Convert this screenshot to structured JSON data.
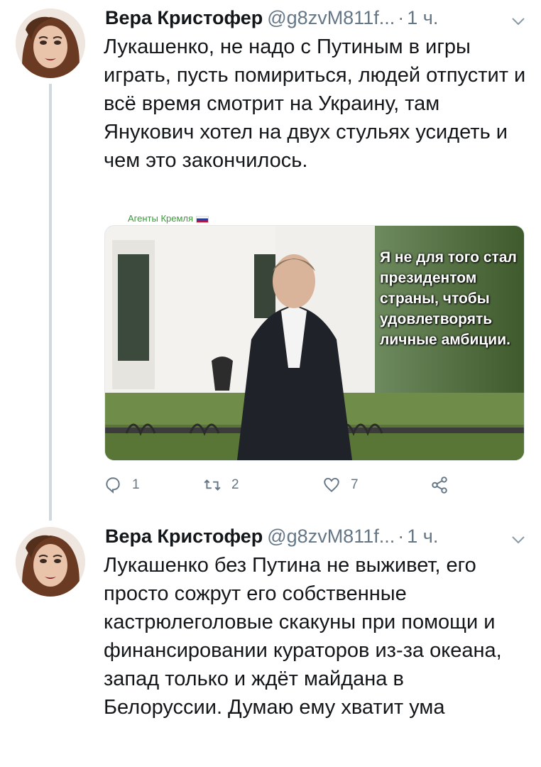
{
  "tweets": [
    {
      "author_name": "Вера Кристофер",
      "handle": "@g8zvM811f...",
      "separator": "·",
      "time": "1 ч.",
      "text": "Лукашенко, не надо с Путиным в игры играть, пусть помириться, людей отпустит и всё время смотрит на Украину, там Янукович хотел на двух стульях усидеть и чем это закончилось.",
      "media": {
        "source_label": "Агенты Кремля",
        "overlay_text": "Я не для того стал президентом страны, чтобы удовлетворять личные амбиции."
      },
      "actions": {
        "reply_count": "1",
        "retweet_count": "2",
        "like_count": "7"
      }
    },
    {
      "author_name": "Вера Кристофер",
      "handle": "@g8zvM811f...",
      "separator": "·",
      "time": "1 ч.",
      "text": "Лукашенко без Путина не выживет, его просто сожрут его собственные кастрюлеголовые скакуны при помощи и финансировании кураторов из-за океана, запад только и ждёт майдана в Белоруссии. Думаю ему хватит ума"
    }
  ],
  "icons": {
    "reply": "reply-icon",
    "retweet": "retweet-icon",
    "like": "heart-icon",
    "share": "share-icon",
    "caret": "chevron-down-icon"
  },
  "colors": {
    "name": "#14171a",
    "secondary": "#657786",
    "thread_line": "#cfd9de",
    "source_label": "#3a9a3a"
  }
}
